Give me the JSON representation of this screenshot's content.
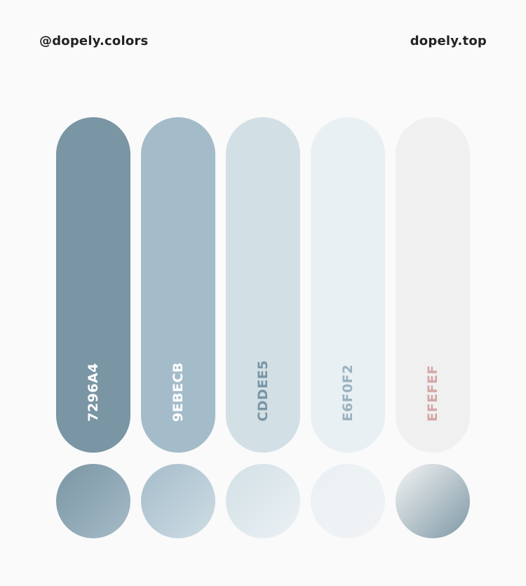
{
  "header": {
    "left": "@dopely.colors",
    "right": "dopely.top"
  },
  "swatches": [
    {
      "hex": "7296A4",
      "color": "#7a95a3",
      "text_color": "#ffffff",
      "gradient": [
        "#7a95a3",
        "#a6bcc8"
      ]
    },
    {
      "hex": "9EBECB",
      "color": "#a4bcc9",
      "text_color": "#ffffff",
      "gradient": [
        "#a4bcc9",
        "#cfdde5"
      ]
    },
    {
      "hex": "CDDEE5",
      "color": "#d2e0e6",
      "text_color": "#7a95a3",
      "gradient": [
        "#d2e0e6",
        "#ebf1f4"
      ]
    },
    {
      "hex": "E6F0F2",
      "color": "#e9f0f4",
      "text_color": "#9bb2be",
      "gradient": [
        "#e9f0f4",
        "#f1f3f4"
      ]
    },
    {
      "hex": "EFEFEF",
      "color": "#f0f0f0",
      "text_color": "#d4a7a6",
      "gradient": [
        "#f4f4f4",
        "#7d98a5"
      ]
    }
  ]
}
